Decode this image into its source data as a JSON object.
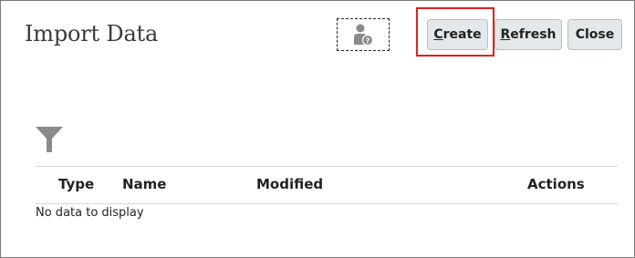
{
  "page": {
    "title": "Import Data"
  },
  "toolbar": {
    "help_icon": "user-help-icon",
    "buttons": [
      {
        "mnemonic": "C",
        "rest": "reate"
      },
      {
        "mnemonic": "R",
        "rest": "efresh"
      },
      {
        "mnemonic": "",
        "rest": "Close"
      }
    ]
  },
  "filter": {
    "icon": "filter-icon"
  },
  "table": {
    "columns": [
      "Type",
      "Name",
      "Modified",
      "Actions"
    ],
    "rows": [],
    "empty_message": "No data to display"
  },
  "colors": {
    "highlight": "#e02020",
    "button_bg": "#e4e8ea",
    "icon_gray": "#8a8a8a"
  }
}
